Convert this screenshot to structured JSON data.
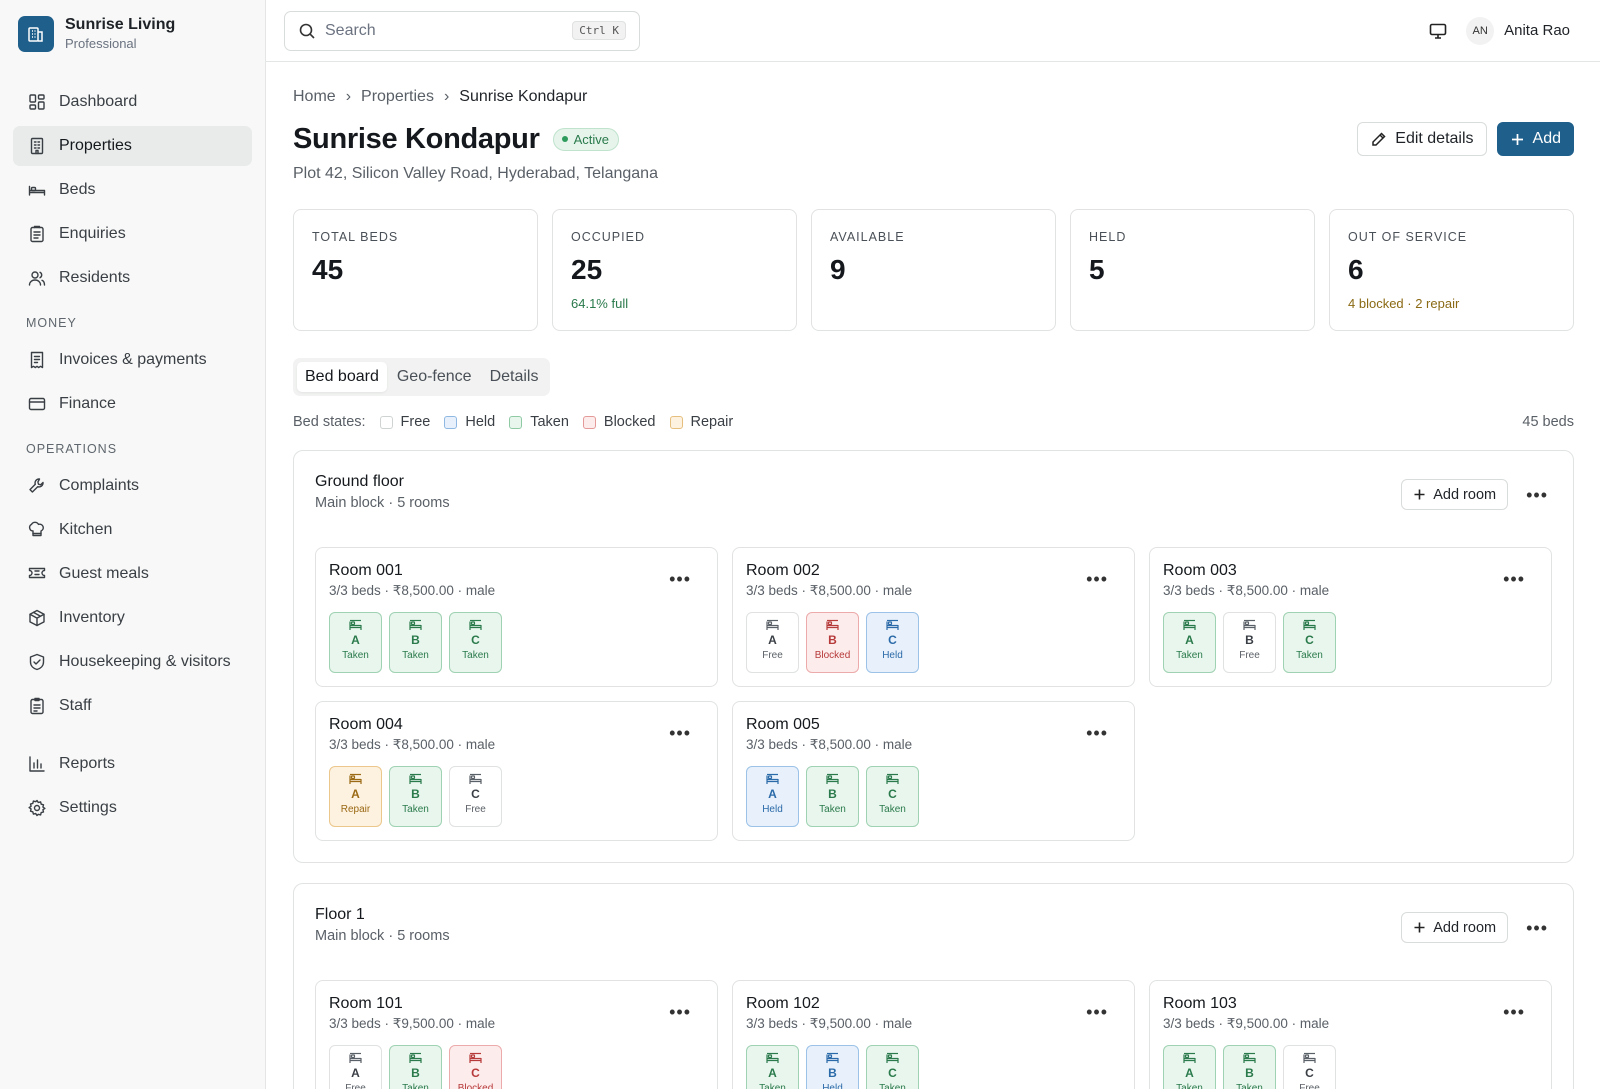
{
  "brand": {
    "name": "Sunrise Living",
    "plan": "Professional"
  },
  "sidebar": {
    "items": [
      {
        "label": "Dashboard",
        "icon": "dashboard-icon",
        "active": false
      },
      {
        "label": "Properties",
        "icon": "building-icon",
        "active": true
      },
      {
        "label": "Beds",
        "icon": "bed-icon"
      },
      {
        "label": "Enquiries",
        "icon": "clipboard-icon"
      },
      {
        "label": "Residents",
        "icon": "users-icon"
      }
    ],
    "money_title": "MONEY",
    "money_items": [
      {
        "label": "Invoices & payments",
        "icon": "receipt-icon"
      },
      {
        "label": "Finance",
        "icon": "card-icon"
      }
    ],
    "ops_title": "OPERATIONS",
    "ops_items": [
      {
        "label": "Complaints",
        "icon": "wrench-icon"
      },
      {
        "label": "Kitchen",
        "icon": "chef-hat-icon"
      },
      {
        "label": "Guest meals",
        "icon": "ticket-icon"
      },
      {
        "label": "Inventory",
        "icon": "package-icon"
      },
      {
        "label": "Housekeeping & visitors",
        "icon": "shield-icon"
      },
      {
        "label": "Staff",
        "icon": "id-icon"
      }
    ],
    "bottom_items": [
      {
        "label": "Reports",
        "icon": "chart-icon"
      },
      {
        "label": "Settings",
        "icon": "gear-icon"
      }
    ]
  },
  "topbar": {
    "search_placeholder": "Search",
    "shortcut": "Ctrl K",
    "user_initials": "AN",
    "user_name": "Anita Rao"
  },
  "breadcrumb": [
    "Home",
    "Properties",
    "Sunrise Kondapur"
  ],
  "property": {
    "name": "Sunrise Kondapur",
    "status": "Active",
    "address": "Plot 42, Silicon Valley Road, Hyderabad, Telangana",
    "edit_label": "Edit details",
    "add_label": "Add"
  },
  "stats": [
    {
      "label": "TOTAL BEDS",
      "value": "45",
      "sub": "",
      "tone": ""
    },
    {
      "label": "OCCUPIED",
      "value": "25",
      "sub": "64.1% full",
      "tone": "green"
    },
    {
      "label": "AVAILABLE",
      "value": "9",
      "sub": "",
      "tone": ""
    },
    {
      "label": "HELD",
      "value": "5",
      "sub": "",
      "tone": ""
    },
    {
      "label": "OUT OF SERVICE",
      "value": "6",
      "sub": "4 blocked · 2 repair",
      "tone": "amber"
    }
  ],
  "tabs": [
    {
      "label": "Bed board",
      "active": true
    },
    {
      "label": "Geo-fence",
      "active": false
    },
    {
      "label": "Details",
      "active": false
    }
  ],
  "legend": {
    "label": "Bed states:",
    "items": [
      "Free",
      "Held",
      "Taken",
      "Blocked",
      "Repair"
    ],
    "count": "45 beds"
  },
  "colors": {
    "accent": "#1f5f8b",
    "free": "#ffffff",
    "held": "#e8f1fb",
    "taken": "#e9f6ee",
    "blocked": "#fdecec",
    "repair": "#fdf1e0"
  },
  "add_room_label": "Add room",
  "floors": [
    {
      "name": "Ground floor",
      "sub": "Main block · 5 rooms",
      "rooms": [
        {
          "name": "Room 001",
          "sub": "3/3 beds · ₹8,500.00 · male",
          "beds": [
            [
              "A",
              "Taken"
            ],
            [
              "B",
              "Taken"
            ],
            [
              "C",
              "Taken"
            ]
          ]
        },
        {
          "name": "Room 002",
          "sub": "3/3 beds · ₹8,500.00 · male",
          "beds": [
            [
              "A",
              "Free"
            ],
            [
              "B",
              "Blocked"
            ],
            [
              "C",
              "Held"
            ]
          ]
        },
        {
          "name": "Room 003",
          "sub": "3/3 beds · ₹8,500.00 · male",
          "beds": [
            [
              "A",
              "Taken"
            ],
            [
              "B",
              "Free"
            ],
            [
              "C",
              "Taken"
            ]
          ]
        },
        {
          "name": "Room 004",
          "sub": "3/3 beds · ₹8,500.00 · male",
          "beds": [
            [
              "A",
              "Repair"
            ],
            [
              "B",
              "Taken"
            ],
            [
              "C",
              "Free"
            ]
          ]
        },
        {
          "name": "Room 005",
          "sub": "3/3 beds · ₹8,500.00 · male",
          "beds": [
            [
              "A",
              "Held"
            ],
            [
              "B",
              "Taken"
            ],
            [
              "C",
              "Taken"
            ]
          ]
        }
      ]
    },
    {
      "name": "Floor 1",
      "sub": "Main block · 5 rooms",
      "rooms": [
        {
          "name": "Room 101",
          "sub": "3/3 beds · ₹9,500.00 · male",
          "beds": [
            [
              "A",
              "Free"
            ],
            [
              "B",
              "Taken"
            ],
            [
              "C",
              "Blocked"
            ]
          ]
        },
        {
          "name": "Room 102",
          "sub": "3/3 beds · ₹9,500.00 · male",
          "beds": [
            [
              "A",
              "Taken"
            ],
            [
              "B",
              "Held"
            ],
            [
              "C",
              "Taken"
            ]
          ]
        },
        {
          "name": "Room 103",
          "sub": "3/3 beds · ₹9,500.00 · male",
          "beds": [
            [
              "A",
              "Taken"
            ],
            [
              "B",
              "Taken"
            ],
            [
              "C",
              "Free"
            ]
          ]
        }
      ]
    }
  ]
}
